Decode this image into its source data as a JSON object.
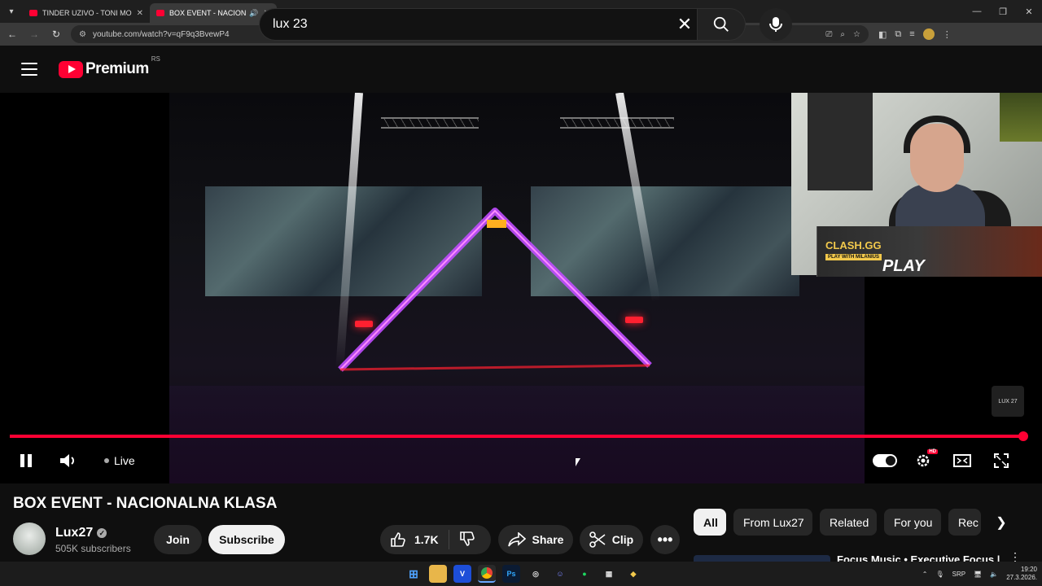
{
  "browser": {
    "tabs": [
      {
        "title": "TINDER UZIVO - TONI MONTANA",
        "close": "✕"
      },
      {
        "title": "BOX EVENT - NACIONALNA KLASA",
        "close": "✕"
      }
    ],
    "new_tab": "+",
    "url": "youtube.com/watch?v=qF9q3BvewP4",
    "window": {
      "minimize": "—",
      "restore": "❐",
      "close": "✕"
    }
  },
  "header": {
    "logo_text": "Premium",
    "country_code": "RS",
    "search_value": "lux 23"
  },
  "player": {
    "live_label": "Live",
    "hd_badge": "HD",
    "watermark": "LUX 27",
    "overlay_banner": {
      "brand": "CLASH.GG",
      "sub": "PLAY WITH MILANIUS",
      "cta": "PLAY"
    },
    "progress_fraction": 1.0
  },
  "video": {
    "title": "BOX EVENT - NACIONALNA KLASA",
    "channel_name": "Lux27",
    "subscribers": "505K subscribers",
    "join_label": "Join",
    "subscribe_label": "Subscribe",
    "likes": "1.7K",
    "share_label": "Share",
    "clip_label": "Clip"
  },
  "chips": {
    "items": [
      "All",
      "From Lux27",
      "Related",
      "For you",
      "Rec"
    ]
  },
  "recommendation": {
    "title": "Focus Music • Executive Focus |"
  },
  "taskbar": {
    "lang": "SRP",
    "time": "19:20",
    "date": "27.3.2026."
  },
  "colors": {
    "accent": "#ff0033",
    "background": "#0f0f0f",
    "chip_bg": "#272727"
  }
}
